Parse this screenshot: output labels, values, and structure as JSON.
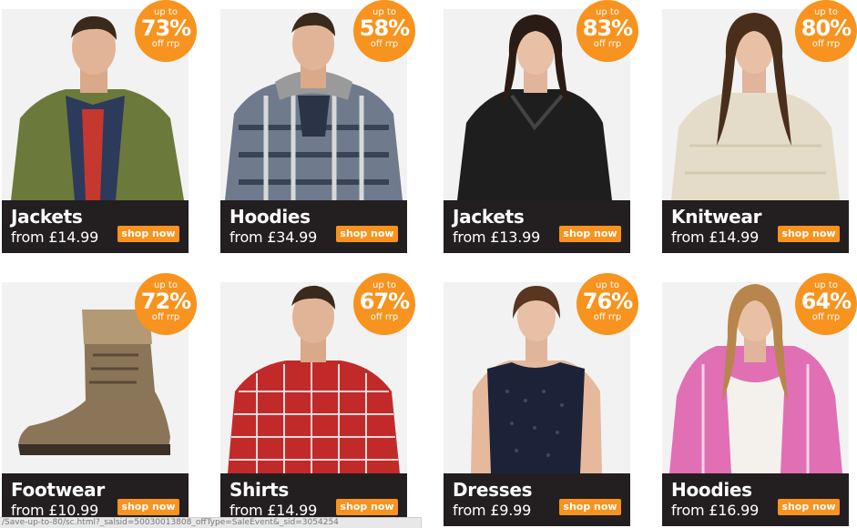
{
  "accent_color": "#f7931e",
  "bar_color": "#231f20",
  "tiles": [
    {
      "category": "Jackets",
      "price": "from £14.99",
      "button": "shop now",
      "badge": {
        "up_to": "up to",
        "percent": "73%",
        "off": "off rrp"
      }
    },
    {
      "category": "Hoodies",
      "price": "from £34.99",
      "button": "shop now",
      "badge": {
        "up_to": "up to",
        "percent": "58%",
        "off": "off rrp"
      }
    },
    {
      "category": "Jackets",
      "price": "from £13.99",
      "button": "shop now",
      "badge": {
        "up_to": "up to",
        "percent": "83%",
        "off": "off rrp"
      }
    },
    {
      "category": "Knitwear",
      "price": "from £14.99",
      "button": "shop now",
      "badge": {
        "up_to": "up to",
        "percent": "80%",
        "off": "off rrp"
      }
    },
    {
      "category": "Footwear",
      "price": "from £10.99",
      "button": "shop now",
      "badge": {
        "up_to": "up to",
        "percent": "72%",
        "off": "off rrp"
      }
    },
    {
      "category": "Shirts",
      "price": "from £14.99",
      "button": "shop now",
      "badge": {
        "up_to": "up to",
        "percent": "67%",
        "off": "off rrp"
      }
    },
    {
      "category": "Dresses",
      "price": "from £9.99",
      "button": "shop now",
      "badge": {
        "up_to": "up to",
        "percent": "76%",
        "off": "off rrp"
      }
    },
    {
      "category": "Hoodies",
      "price": "from £16.99",
      "button": "shop now",
      "badge": {
        "up_to": "up to",
        "percent": "64%",
        "off": "off rrp"
      }
    }
  ],
  "status_bar": {
    "url": "/Save-up-to-80/sc.html?_salsid=50030013808_offType=SaleEvent&_sid=3054254"
  }
}
